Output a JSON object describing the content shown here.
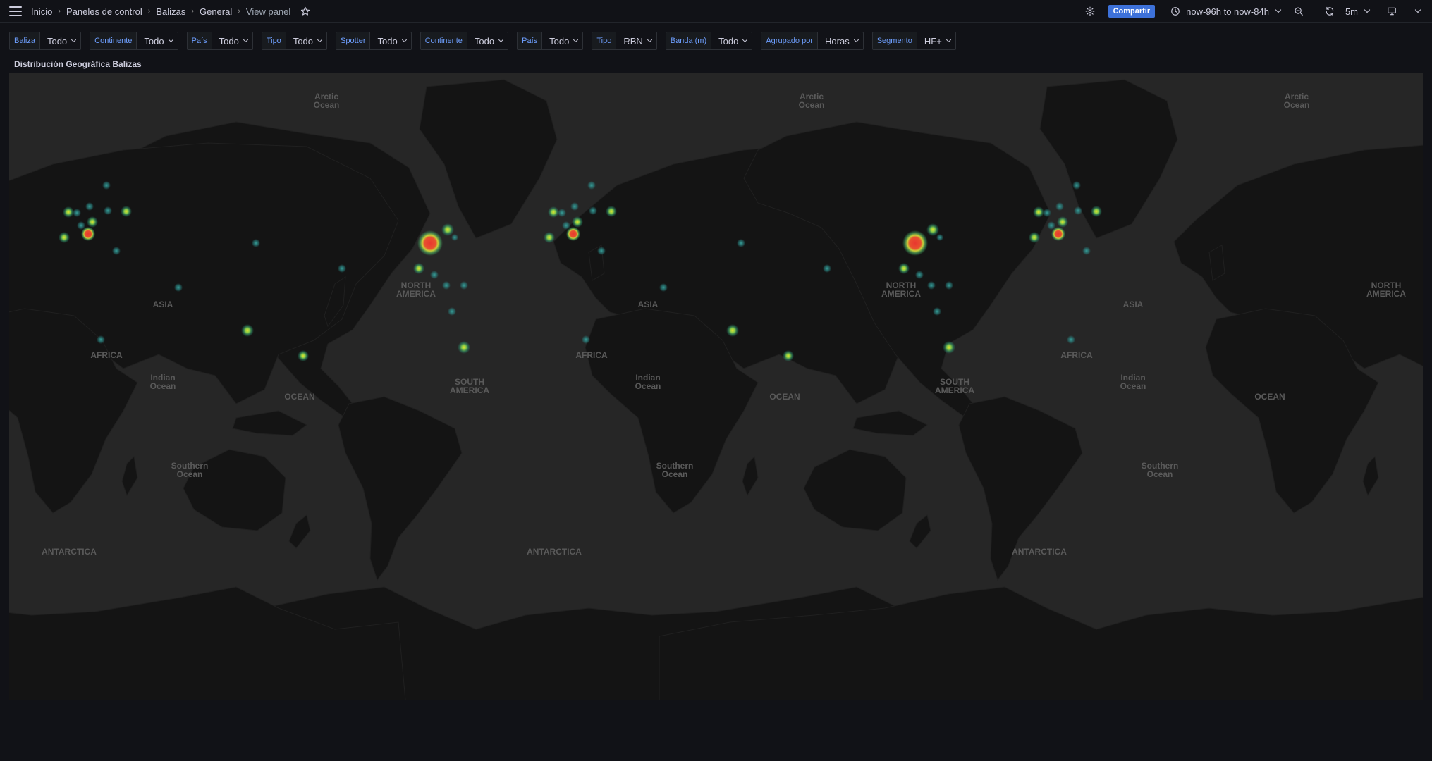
{
  "breadcrumb": [
    "Inicio",
    "Paneles de control",
    "Balizas",
    "General",
    "View panel"
  ],
  "toolbar": {
    "share_label": "Compartir",
    "time_range": "now-96h to now-84h",
    "refresh_interval": "5m"
  },
  "variables": [
    {
      "label": "Baliza",
      "value": "Todo"
    },
    {
      "label": "Continente",
      "value": "Todo"
    },
    {
      "label": "País",
      "value": "Todo"
    },
    {
      "label": "Tipo",
      "value": "Todo"
    },
    {
      "label": "Spotter",
      "value": "Todo"
    },
    {
      "label": "Continente",
      "value": "Todo"
    },
    {
      "label": "País",
      "value": "Todo"
    },
    {
      "label": "Tipo",
      "value": "RBN"
    },
    {
      "label": "Banda (m)",
      "value": "Todo"
    },
    {
      "label": "Agrupado por",
      "value": "Horas"
    },
    {
      "label": "Segmento",
      "value": "HF+"
    }
  ],
  "panel": {
    "title": "Distribución Geográfica Balizas",
    "map_labels": [
      "Arctic",
      "Ocean",
      "NORTH",
      "AMERICA",
      "ASIA",
      "AFRICA",
      "Indian",
      "Ocean",
      "SOUTH",
      "AMERICA",
      "OCEAN",
      "Southern",
      "Ocean",
      "ANTARCTICA"
    ]
  },
  "colors": {
    "accent": "#3d71d9",
    "heat_low": "#2f8f8f",
    "heat_mid": "#8ad34a",
    "heat_high": "#e8382f"
  }
}
